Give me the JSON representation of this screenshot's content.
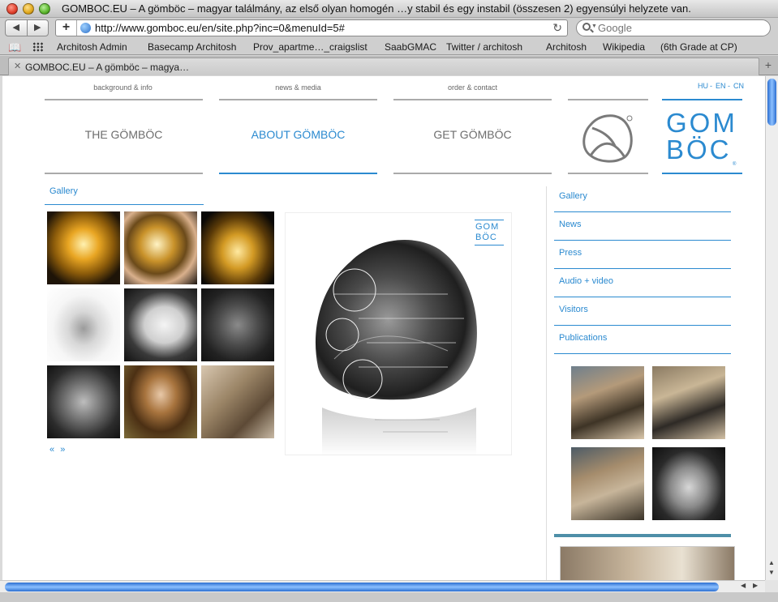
{
  "browser": {
    "window_title": "GOMBOC.EU – A gömböc – magyar találmány, az első olyan homogén …y stabil és egy instabil (összesen 2) egyensúlyi helyzete van.",
    "url": "http://www.gomboc.eu/en/site.php?inc=0&menuId=5#",
    "search_placeholder": "Google",
    "bookmarks": [
      "Architosh Admin",
      "Basecamp Architosh",
      "Prov_apartme…_craigslist",
      "SaabGMAC",
      "Twitter / architosh",
      "Architosh",
      "Wikipedia",
      "(6th Grade at CP)"
    ],
    "tab_title": "GOMBOC.EU – A gömböc – magya…"
  },
  "site": {
    "sublinks": [
      "background & info",
      "news & media",
      "order & contact"
    ],
    "nav": [
      "THE GÖMBÖC",
      "ABOUT GÖMBÖC",
      "GET GÖMBÖC"
    ],
    "languages": [
      "HU",
      "EN",
      "CN"
    ],
    "lang_separator": "-",
    "logo_line1": "GOM",
    "logo_line2": "BÖC",
    "registered": "®",
    "gallery_tab": "Gallery",
    "pager_prev": "«",
    "pager_next": "»",
    "main_logo_line1": "GOM",
    "main_logo_line2": "BÖC",
    "sidebar": [
      "Gallery",
      "News",
      "Press",
      "Audio + video",
      "Visitors",
      "Publications"
    ]
  },
  "colors": {
    "accent": "#2b8ad0",
    "nav_gray": "#6d6d6d"
  }
}
